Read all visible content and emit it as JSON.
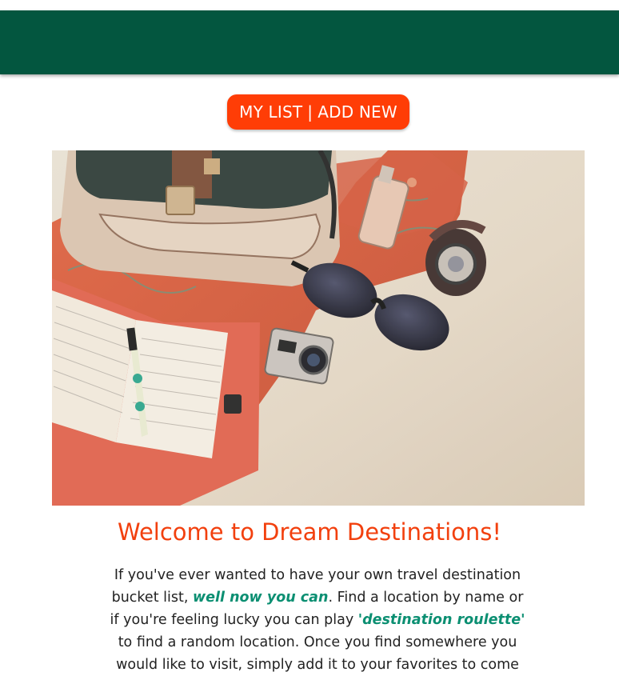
{
  "header": {
    "brand_color": "#03563f"
  },
  "nav": {
    "my_list_label": "MY LIST",
    "separator": "|",
    "add_new_label": "ADD NEW",
    "accent_color": "#ff3d06"
  },
  "hero_image": {
    "icon": "travel-flatlay-image"
  },
  "main": {
    "title": "Welcome to Dream Destinations!",
    "intro": {
      "part1": "If you've ever wanted to have your own travel destination bucket list, ",
      "emphasis1": "well now you can",
      "part2": ". Find a location by name or if you're feeling lucky you can play ",
      "emphasis2": "'destination roulette'",
      "part3": " to find a random location. Once you find somewhere you would like to visit, simply add it to your favorites to come"
    },
    "accent_color": "#0b8f72"
  }
}
